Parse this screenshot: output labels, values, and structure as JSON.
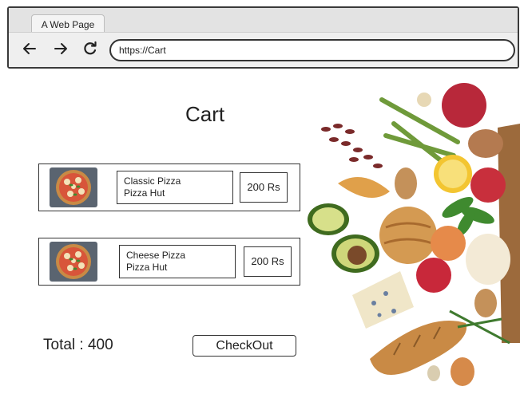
{
  "browser": {
    "tab_title": "A Web Page",
    "url": "https://Cart",
    "back_icon": "arrow-left-icon",
    "forward_icon": "arrow-right-icon",
    "reload_icon": "reload-icon"
  },
  "page": {
    "title": "Cart"
  },
  "cart": {
    "items": [
      {
        "name": "Classic Pizza",
        "vendor": "Pizza Hut",
        "price": "200 Rs",
        "image_icon": "pizza-image"
      },
      {
        "name": "Cheese Pizza",
        "vendor": "Pizza Hut",
        "price": "200 Rs",
        "image_icon": "pizza-image"
      }
    ],
    "total_label": "Total : 400",
    "checkout_label": "CheckOut"
  },
  "hero_image": "groceries-image",
  "colors": {
    "frame": "#333333",
    "toolbar": "#efefef"
  }
}
